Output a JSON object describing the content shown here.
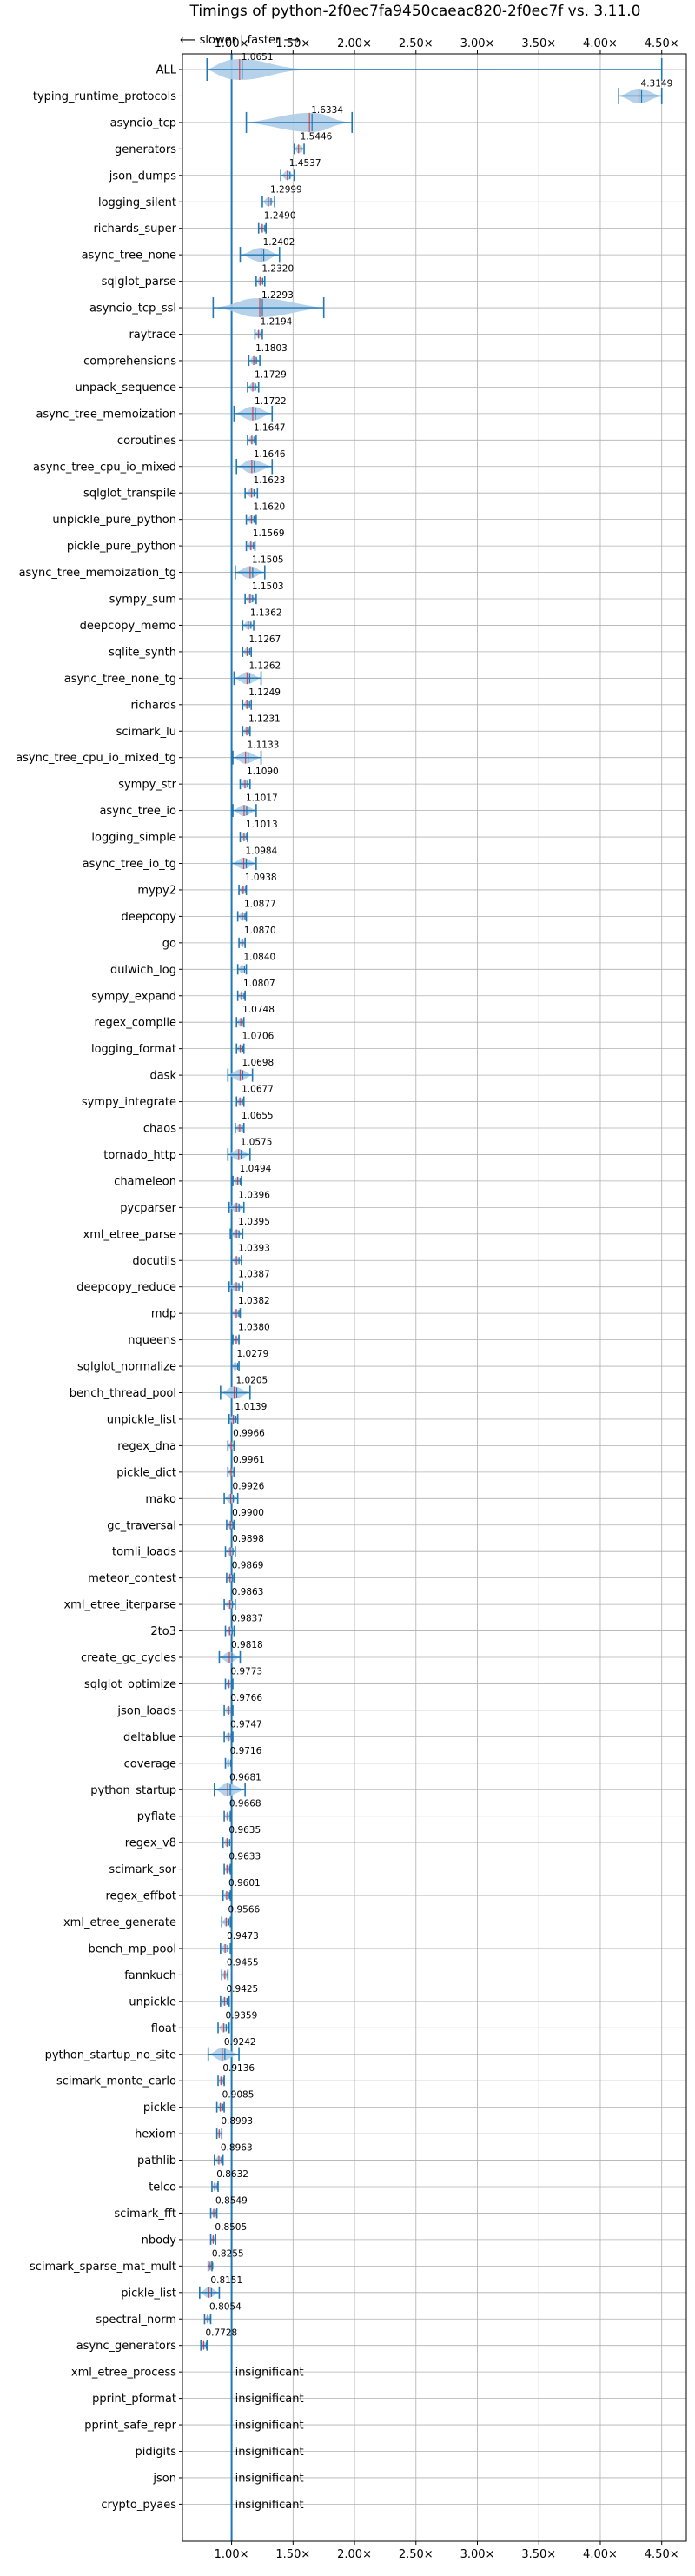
{
  "chart_data": {
    "type": "violin",
    "title": "Timings of python-2f0ec7fa9450caeac820-2f0ec7f vs. 3.11.0",
    "direction_label": "⟵ slower  |  faster ⟶",
    "xlim": [
      0.6,
      4.7
    ],
    "x_ticks": [
      1.0,
      1.5,
      2.0,
      2.5,
      3.0,
      3.5,
      4.0,
      4.5
    ],
    "x_tick_labels": [
      "1.00×",
      "1.50×",
      "2.00×",
      "2.50×",
      "3.00×",
      "3.50×",
      "4.00×",
      "4.50×"
    ],
    "reference_line": 1.0,
    "insignificant_label": "insignificant",
    "colors": {
      "violin": "#aecde8",
      "line": "#1f77b4",
      "median": "#d62728",
      "grid": "#b0b0b0"
    },
    "benchmarks": [
      {
        "name": "ALL",
        "value": 1.0651,
        "label": "1.0651",
        "lo": 0.8,
        "hi": 4.5
      },
      {
        "name": "typing_runtime_protocols",
        "value": 4.3149,
        "label": "4.3149",
        "lo": 4.15,
        "hi": 4.5
      },
      {
        "name": "asyncio_tcp",
        "value": 1.6334,
        "label": "1.6334",
        "lo": 1.12,
        "hi": 1.98
      },
      {
        "name": "generators",
        "value": 1.5446,
        "label": "1.5446",
        "lo": 1.51,
        "hi": 1.59
      },
      {
        "name": "json_dumps",
        "value": 1.4537,
        "label": "1.4537",
        "lo": 1.4,
        "hi": 1.51
      },
      {
        "name": "logging_silent",
        "value": 1.2999,
        "label": "1.2999",
        "lo": 1.25,
        "hi": 1.35
      },
      {
        "name": "richards_super",
        "value": 1.249,
        "label": "1.2490",
        "lo": 1.22,
        "hi": 1.28
      },
      {
        "name": "async_tree_none",
        "value": 1.2402,
        "label": "1.2402",
        "lo": 1.07,
        "hi": 1.39
      },
      {
        "name": "sqlglot_parse",
        "value": 1.232,
        "label": "1.2320",
        "lo": 1.2,
        "hi": 1.27
      },
      {
        "name": "asyncio_tcp_ssl",
        "value": 1.2293,
        "label": "1.2293",
        "lo": 0.85,
        "hi": 1.75
      },
      {
        "name": "raytrace",
        "value": 1.2194,
        "label": "1.2194",
        "lo": 1.19,
        "hi": 1.25
      },
      {
        "name": "comprehensions",
        "value": 1.1803,
        "label": "1.1803",
        "lo": 1.14,
        "hi": 1.23
      },
      {
        "name": "unpack_sequence",
        "value": 1.1729,
        "label": "1.1729",
        "lo": 1.13,
        "hi": 1.22
      },
      {
        "name": "async_tree_memoization",
        "value": 1.1722,
        "label": "1.1722",
        "lo": 1.02,
        "hi": 1.33
      },
      {
        "name": "coroutines",
        "value": 1.1647,
        "label": "1.1647",
        "lo": 1.13,
        "hi": 1.2
      },
      {
        "name": "async_tree_cpu_io_mixed",
        "value": 1.1646,
        "label": "1.1646",
        "lo": 1.04,
        "hi": 1.33
      },
      {
        "name": "sqlglot_transpile",
        "value": 1.1623,
        "label": "1.1623",
        "lo": 1.11,
        "hi": 1.21
      },
      {
        "name": "unpickle_pure_python",
        "value": 1.162,
        "label": "1.1620",
        "lo": 1.12,
        "hi": 1.2
      },
      {
        "name": "pickle_pure_python",
        "value": 1.1569,
        "label": "1.1569",
        "lo": 1.12,
        "hi": 1.19
      },
      {
        "name": "async_tree_memoization_tg",
        "value": 1.1505,
        "label": "1.1505",
        "lo": 1.03,
        "hi": 1.27
      },
      {
        "name": "sympy_sum",
        "value": 1.1503,
        "label": "1.1503",
        "lo": 1.11,
        "hi": 1.2
      },
      {
        "name": "deepcopy_memo",
        "value": 1.1362,
        "label": "1.1362",
        "lo": 1.09,
        "hi": 1.18
      },
      {
        "name": "sqlite_synth",
        "value": 1.1267,
        "label": "1.1267",
        "lo": 1.09,
        "hi": 1.16
      },
      {
        "name": "async_tree_none_tg",
        "value": 1.1262,
        "label": "1.1262",
        "lo": 1.02,
        "hi": 1.24
      },
      {
        "name": "richards",
        "value": 1.1249,
        "label": "1.1249",
        "lo": 1.09,
        "hi": 1.16
      },
      {
        "name": "scimark_lu",
        "value": 1.1231,
        "label": "1.1231",
        "lo": 1.09,
        "hi": 1.15
      },
      {
        "name": "async_tree_cpu_io_mixed_tg",
        "value": 1.1133,
        "label": "1.1133",
        "lo": 1.01,
        "hi": 1.24
      },
      {
        "name": "sympy_str",
        "value": 1.109,
        "label": "1.1090",
        "lo": 1.07,
        "hi": 1.15
      },
      {
        "name": "async_tree_io",
        "value": 1.1017,
        "label": "1.1017",
        "lo": 1.01,
        "hi": 1.2
      },
      {
        "name": "logging_simple",
        "value": 1.1013,
        "label": "1.1013",
        "lo": 1.07,
        "hi": 1.13
      },
      {
        "name": "async_tree_io_tg",
        "value": 1.0984,
        "label": "1.0984",
        "lo": 1.0,
        "hi": 1.2
      },
      {
        "name": "mypy2",
        "value": 1.0938,
        "label": "1.0938",
        "lo": 1.06,
        "hi": 1.12
      },
      {
        "name": "deepcopy",
        "value": 1.0877,
        "label": "1.0877",
        "lo": 1.05,
        "hi": 1.12
      },
      {
        "name": "go",
        "value": 1.087,
        "label": "1.0870",
        "lo": 1.06,
        "hi": 1.11
      },
      {
        "name": "dulwich_log",
        "value": 1.084,
        "label": "1.0840",
        "lo": 1.05,
        "hi": 1.12
      },
      {
        "name": "sympy_expand",
        "value": 1.0807,
        "label": "1.0807",
        "lo": 1.05,
        "hi": 1.11
      },
      {
        "name": "regex_compile",
        "value": 1.0748,
        "label": "1.0748",
        "lo": 1.04,
        "hi": 1.1
      },
      {
        "name": "logging_format",
        "value": 1.0706,
        "label": "1.0706",
        "lo": 1.04,
        "hi": 1.1
      },
      {
        "name": "dask",
        "value": 1.0698,
        "label": "1.0698",
        "lo": 0.97,
        "hi": 1.17
      },
      {
        "name": "sympy_integrate",
        "value": 1.0677,
        "label": "1.0677",
        "lo": 1.04,
        "hi": 1.1
      },
      {
        "name": "chaos",
        "value": 1.0655,
        "label": "1.0655",
        "lo": 1.03,
        "hi": 1.1
      },
      {
        "name": "tornado_http",
        "value": 1.0575,
        "label": "1.0575",
        "lo": 0.97,
        "hi": 1.15
      },
      {
        "name": "chameleon",
        "value": 1.0494,
        "label": "1.0494",
        "lo": 1.01,
        "hi": 1.08
      },
      {
        "name": "pycparser",
        "value": 1.0396,
        "label": "1.0396",
        "lo": 0.98,
        "hi": 1.1
      },
      {
        "name": "xml_etree_parse",
        "value": 1.0395,
        "label": "1.0395",
        "lo": 0.99,
        "hi": 1.09
      },
      {
        "name": "docutils",
        "value": 1.0393,
        "label": "1.0393",
        "lo": 1.0,
        "hi": 1.08
      },
      {
        "name": "deepcopy_reduce",
        "value": 1.0387,
        "label": "1.0387",
        "lo": 0.98,
        "hi": 1.09
      },
      {
        "name": "mdp",
        "value": 1.0382,
        "label": "1.0382",
        "lo": 1.0,
        "hi": 1.07
      },
      {
        "name": "nqueens",
        "value": 1.038,
        "label": "1.0380",
        "lo": 1.01,
        "hi": 1.06
      },
      {
        "name": "sqlglot_normalize",
        "value": 1.0279,
        "label": "1.0279",
        "lo": 1.0,
        "hi": 1.06
      },
      {
        "name": "bench_thread_pool",
        "value": 1.0205,
        "label": "1.0205",
        "lo": 0.91,
        "hi": 1.15
      },
      {
        "name": "unpickle_list",
        "value": 1.0139,
        "label": "1.0139",
        "lo": 0.98,
        "hi": 1.05
      },
      {
        "name": "regex_dna",
        "value": 0.9966,
        "label": "0.9966",
        "lo": 0.97,
        "hi": 1.02
      },
      {
        "name": "pickle_dict",
        "value": 0.9961,
        "label": "0.9961",
        "lo": 0.97,
        "hi": 1.02
      },
      {
        "name": "mako",
        "value": 0.9926,
        "label": "0.9926",
        "lo": 0.94,
        "hi": 1.05
      },
      {
        "name": "gc_traversal",
        "value": 0.99,
        "label": "0.9900",
        "lo": 0.96,
        "hi": 1.02
      },
      {
        "name": "tomli_loads",
        "value": 0.9898,
        "label": "0.9898",
        "lo": 0.95,
        "hi": 1.03
      },
      {
        "name": "meteor_contest",
        "value": 0.9869,
        "label": "0.9869",
        "lo": 0.96,
        "hi": 1.02
      },
      {
        "name": "xml_etree_iterparse",
        "value": 0.9863,
        "label": "0.9863",
        "lo": 0.94,
        "hi": 1.03
      },
      {
        "name": "2to3",
        "value": 0.9837,
        "label": "0.9837",
        "lo": 0.95,
        "hi": 1.02
      },
      {
        "name": "create_gc_cycles",
        "value": 0.9818,
        "label": "0.9818",
        "lo": 0.9,
        "hi": 1.07
      },
      {
        "name": "sqlglot_optimize",
        "value": 0.9773,
        "label": "0.9773",
        "lo": 0.95,
        "hi": 1.01
      },
      {
        "name": "json_loads",
        "value": 0.9766,
        "label": "0.9766",
        "lo": 0.94,
        "hi": 1.01
      },
      {
        "name": "deltablue",
        "value": 0.9747,
        "label": "0.9747",
        "lo": 0.94,
        "hi": 1.01
      },
      {
        "name": "coverage",
        "value": 0.9716,
        "label": "0.9716",
        "lo": 0.95,
        "hi": 1.0
      },
      {
        "name": "python_startup",
        "value": 0.9681,
        "label": "0.9681",
        "lo": 0.86,
        "hi": 1.11
      },
      {
        "name": "pyflate",
        "value": 0.9668,
        "label": "0.9668",
        "lo": 0.94,
        "hi": 0.99
      },
      {
        "name": "regex_v8",
        "value": 0.9635,
        "label": "0.9635",
        "lo": 0.93,
        "hi": 1.0
      },
      {
        "name": "scimark_sor",
        "value": 0.9633,
        "label": "0.9633",
        "lo": 0.94,
        "hi": 0.99
      },
      {
        "name": "regex_effbot",
        "value": 0.9601,
        "label": "0.9601",
        "lo": 0.93,
        "hi": 0.99
      },
      {
        "name": "xml_etree_generate",
        "value": 0.9566,
        "label": "0.9566",
        "lo": 0.92,
        "hi": 0.99
      },
      {
        "name": "bench_mp_pool",
        "value": 0.9473,
        "label": "0.9473",
        "lo": 0.91,
        "hi": 0.99
      },
      {
        "name": "fannkuch",
        "value": 0.9455,
        "label": "0.9455",
        "lo": 0.92,
        "hi": 0.97
      },
      {
        "name": "unpickle",
        "value": 0.9425,
        "label": "0.9425",
        "lo": 0.91,
        "hi": 0.98
      },
      {
        "name": "float",
        "value": 0.9359,
        "label": "0.9359",
        "lo": 0.89,
        "hi": 0.98
      },
      {
        "name": "python_startup_no_site",
        "value": 0.9242,
        "label": "0.9242",
        "lo": 0.81,
        "hi": 1.06
      },
      {
        "name": "scimark_monte_carlo",
        "value": 0.9136,
        "label": "0.9136",
        "lo": 0.89,
        "hi": 0.94
      },
      {
        "name": "pickle",
        "value": 0.9085,
        "label": "0.9085",
        "lo": 0.88,
        "hi": 0.94
      },
      {
        "name": "hexiom",
        "value": 0.8993,
        "label": "0.8993",
        "lo": 0.88,
        "hi": 0.92
      },
      {
        "name": "pathlib",
        "value": 0.8963,
        "label": "0.8963",
        "lo": 0.86,
        "hi": 0.93
      },
      {
        "name": "telco",
        "value": 0.8632,
        "label": "0.8632",
        "lo": 0.84,
        "hi": 0.89
      },
      {
        "name": "scimark_fft",
        "value": 0.8549,
        "label": "0.8549",
        "lo": 0.83,
        "hi": 0.88
      },
      {
        "name": "nbody",
        "value": 0.8505,
        "label": "0.8505",
        "lo": 0.83,
        "hi": 0.87
      },
      {
        "name": "scimark_sparse_mat_mult",
        "value": 0.8255,
        "label": "0.8255",
        "lo": 0.81,
        "hi": 0.84
      },
      {
        "name": "pickle_list",
        "value": 0.8151,
        "label": "0.8151",
        "lo": 0.74,
        "hi": 0.9
      },
      {
        "name": "spectral_norm",
        "value": 0.8054,
        "label": "0.8054",
        "lo": 0.78,
        "hi": 0.83
      },
      {
        "name": "async_generators",
        "value": 0.7728,
        "label": "0.7728",
        "lo": 0.75,
        "hi": 0.8
      },
      {
        "name": "xml_etree_process",
        "insignificant": true
      },
      {
        "name": "pprint_pformat",
        "insignificant": true
      },
      {
        "name": "pprint_safe_repr",
        "insignificant": true
      },
      {
        "name": "pidigits",
        "insignificant": true
      },
      {
        "name": "json",
        "insignificant": true
      },
      {
        "name": "crypto_pyaes",
        "insignificant": true
      }
    ]
  }
}
